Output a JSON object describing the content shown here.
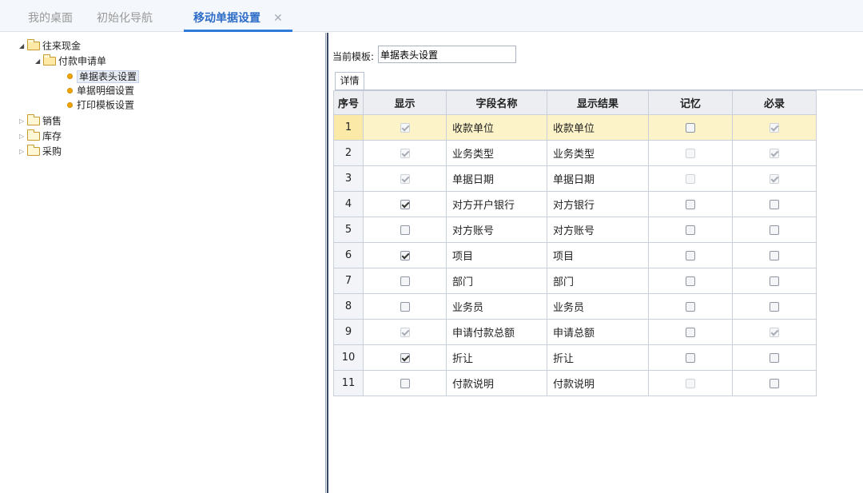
{
  "tabs": [
    {
      "label": "我的桌面",
      "active": false
    },
    {
      "label": "初始化导航",
      "active": false
    },
    {
      "label": "移动单据设置",
      "active": true,
      "closable": true
    }
  ],
  "close_glyph": "✕",
  "tree": {
    "root": {
      "label": "往来现金",
      "expanded": true
    },
    "child": {
      "label": "付款申请单",
      "expanded": true
    },
    "leaves": [
      {
        "label": "单据表头设置",
        "selected": true
      },
      {
        "label": "单据明细设置",
        "selected": false
      },
      {
        "label": "打印模板设置",
        "selected": false
      }
    ],
    "collapsed": [
      {
        "label": "销售"
      },
      {
        "label": "库存"
      },
      {
        "label": "采购"
      }
    ]
  },
  "template": {
    "label": "当前模板:",
    "value": "单据表头设置"
  },
  "detail_tab": "详情",
  "table": {
    "headers": [
      "序号",
      "显示",
      "字段名称",
      "显示结果",
      "记忆",
      "必录"
    ],
    "highlighted_row": 1,
    "rows": [
      {
        "idx": "1",
        "show": {
          "checked": true,
          "disabled": true
        },
        "field": "收款单位",
        "result": "收款单位",
        "memo": {
          "checked": false,
          "disabled": false
        },
        "required": {
          "checked": true,
          "disabled": true
        }
      },
      {
        "idx": "2",
        "show": {
          "checked": true,
          "disabled": true
        },
        "field": "业务类型",
        "result": "业务类型",
        "memo": {
          "checked": false,
          "disabled": true
        },
        "required": {
          "checked": true,
          "disabled": true
        }
      },
      {
        "idx": "3",
        "show": {
          "checked": true,
          "disabled": true
        },
        "field": "单据日期",
        "result": "单据日期",
        "memo": {
          "checked": false,
          "disabled": true
        },
        "required": {
          "checked": true,
          "disabled": true
        }
      },
      {
        "idx": "4",
        "show": {
          "checked": true,
          "disabled": false
        },
        "field": "对方开户银行",
        "result": "对方银行",
        "memo": {
          "checked": false,
          "disabled": false
        },
        "required": {
          "checked": false,
          "disabled": false
        }
      },
      {
        "idx": "5",
        "show": {
          "checked": false,
          "disabled": false
        },
        "field": "对方账号",
        "result": "对方账号",
        "memo": {
          "checked": false,
          "disabled": false
        },
        "required": {
          "checked": false,
          "disabled": false
        }
      },
      {
        "idx": "6",
        "show": {
          "checked": true,
          "disabled": false
        },
        "field": "项目",
        "result": "项目",
        "memo": {
          "checked": false,
          "disabled": false
        },
        "required": {
          "checked": false,
          "disabled": false
        }
      },
      {
        "idx": "7",
        "show": {
          "checked": false,
          "disabled": false
        },
        "field": "部门",
        "result": "部门",
        "memo": {
          "checked": false,
          "disabled": false
        },
        "required": {
          "checked": false,
          "disabled": false
        }
      },
      {
        "idx": "8",
        "show": {
          "checked": false,
          "disabled": false
        },
        "field": "业务员",
        "result": "业务员",
        "memo": {
          "checked": false,
          "disabled": false
        },
        "required": {
          "checked": false,
          "disabled": false
        }
      },
      {
        "idx": "9",
        "show": {
          "checked": true,
          "disabled": true
        },
        "field": "申请付款总额",
        "result": "申请总额",
        "memo": {
          "checked": false,
          "disabled": false
        },
        "required": {
          "checked": true,
          "disabled": true
        }
      },
      {
        "idx": "10",
        "show": {
          "checked": true,
          "disabled": false
        },
        "field": "折让",
        "result": "折让",
        "memo": {
          "checked": false,
          "disabled": false
        },
        "required": {
          "checked": false,
          "disabled": false
        }
      },
      {
        "idx": "11",
        "show": {
          "checked": false,
          "disabled": false
        },
        "field": "付款说明",
        "result": "付款说明",
        "memo": {
          "checked": false,
          "disabled": true
        },
        "required": {
          "checked": false,
          "disabled": false
        }
      }
    ]
  }
}
